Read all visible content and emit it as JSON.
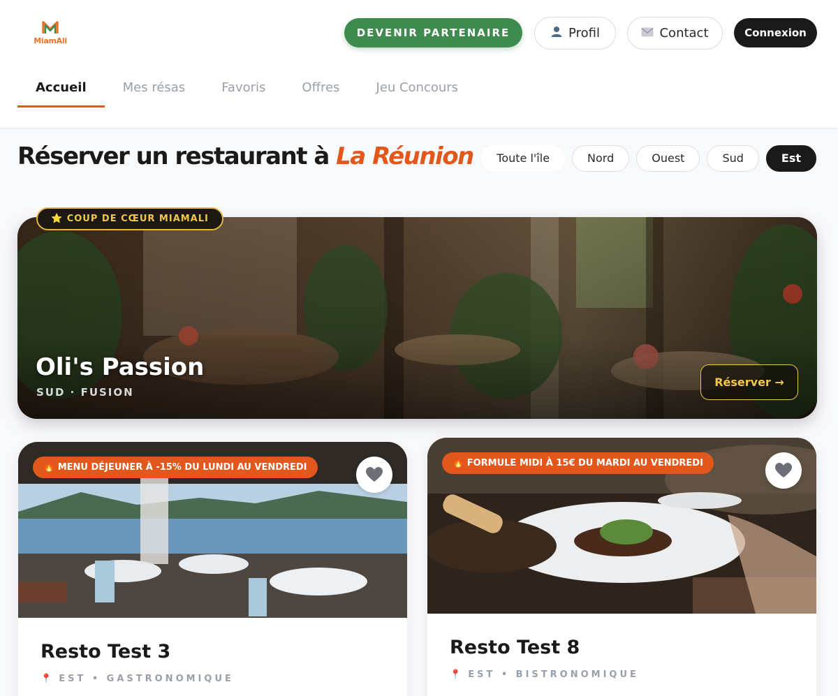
{
  "brand": {
    "name": "MiamAli",
    "colors": {
      "green": "#3f8a4e",
      "orange": "#e2571c",
      "gold": "#f2c74c",
      "dark": "#1a1a1a"
    }
  },
  "header": {
    "partner_label": "DEVENIR PARTENAIRE",
    "profil_icon": "user-icon",
    "profil_label": "Profil",
    "contact_icon": "envelope-icon",
    "contact_label": "Contact",
    "connexion_label": "Connexion"
  },
  "tabs": [
    {
      "label": "Accueil",
      "active": true
    },
    {
      "label": "Mes résas"
    },
    {
      "label": "Favoris"
    },
    {
      "label": "Offres"
    },
    {
      "label": "Jeu Concours"
    }
  ],
  "page": {
    "title_main": "Réserver un restaurant à",
    "title_accent": "La Réunion"
  },
  "regions": [
    {
      "label": "Toute l'île"
    },
    {
      "label": "Nord"
    },
    {
      "label": "Ouest"
    },
    {
      "label": "Sud"
    },
    {
      "label": "Est",
      "active": true
    }
  ],
  "featured": {
    "badge": "⭐ COUP DE CŒUR MIAMALI",
    "name": "Oli's Passion",
    "meta": "SUD · FUSION",
    "cta": "Réserver →"
  },
  "cards": [
    {
      "offer": "🔥 MENU DÉJEUNER À -15% DU LUNDI AU VENDREDI",
      "name": "Resto Test 3",
      "meta": "EST • GASTRONOMIQUE",
      "fav_icon": "heart-icon"
    },
    {
      "offer": "🔥 FORMULE MIDI À 15€ DU MARDI AU VENDREDI",
      "name": "Resto Test 8",
      "meta": "EST • BISTRONOMIQUE",
      "fav_icon": "heart-icon"
    }
  ],
  "meta_icon": "pin-icon"
}
